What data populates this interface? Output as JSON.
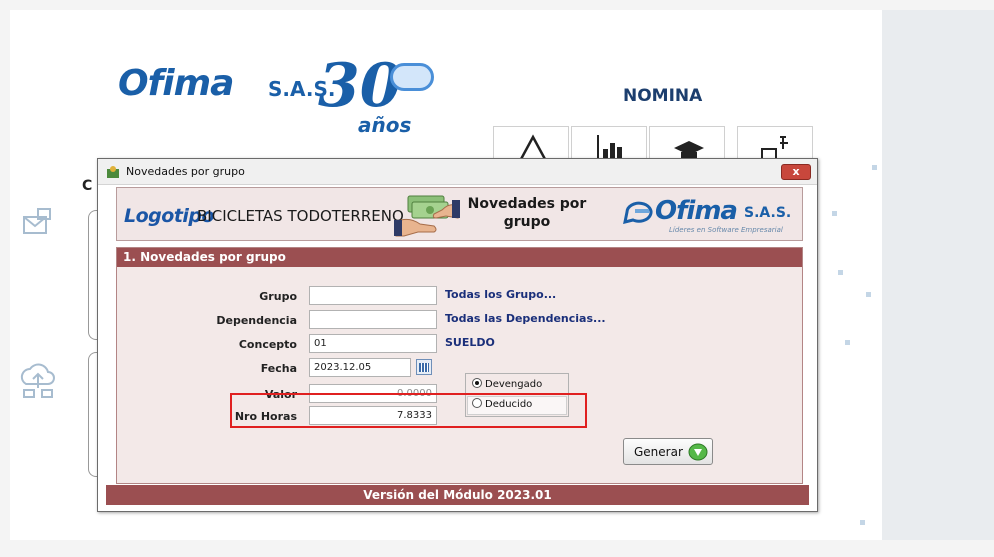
{
  "background": {
    "brand": "Ofima",
    "brand_suffix": "S.A.S.",
    "anniversary_number": "30",
    "anniversary_word": "años",
    "module_title": "NOMINA",
    "tiles": [
      "warning-icon",
      "bar-chart-icon",
      "graduation-cap-icon",
      "document-settings-icon"
    ]
  },
  "dialog": {
    "title": "Novedades por grupo",
    "close_label": "x",
    "banner": {
      "logo_word": "Logotipo",
      "company_name": "BICICLETAS TODOTERRENO",
      "module_line1": "Novedades por",
      "module_line2": "grupo",
      "brand": "Ofima",
      "brand_suffix": "S.A.S.",
      "tagline": "Líderes en Software Empresarial"
    },
    "section_header": "1. Novedades por grupo",
    "fields": {
      "grupo": {
        "label": "Grupo",
        "value": "",
        "hint": "Todas los Grupo..."
      },
      "dependencia": {
        "label": "Dependencia",
        "value": "",
        "hint": "Todas las Dependencias..."
      },
      "concepto": {
        "label": "Concepto",
        "value": "01",
        "hint": "SUELDO"
      },
      "fecha": {
        "label": "Fecha",
        "value": "2023.12.05"
      },
      "valor": {
        "label": "Valor",
        "value": "0.0000"
      },
      "nro_horas": {
        "label": "Nro Horas",
        "value": "7.8333"
      }
    },
    "radio": {
      "option1": "Devengado",
      "option2": "Deducido",
      "selected": "Devengado"
    },
    "generate_label": "Generar",
    "footer": "Versión del Módulo 2023.01"
  },
  "colors": {
    "header": "#9b4f51",
    "panel": "#f3e9e8",
    "link": "#1a2f7a",
    "highlight": "#e02020",
    "brand": "#1a5fa8"
  }
}
